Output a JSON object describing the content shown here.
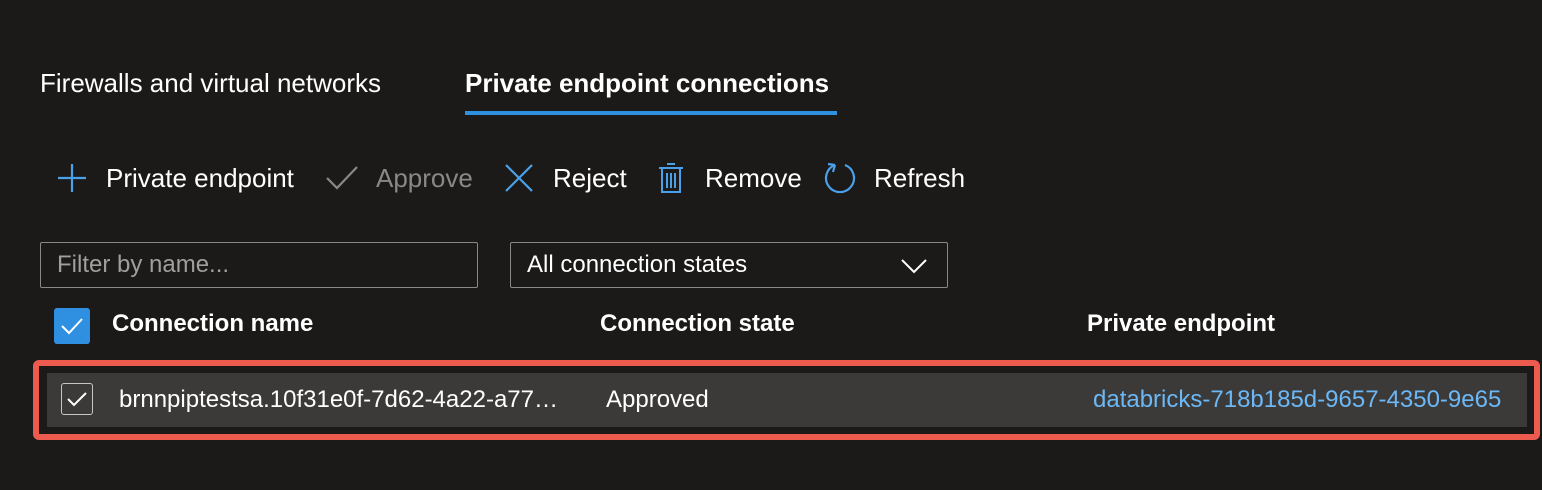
{
  "tabs": [
    {
      "label": "Firewalls and virtual networks",
      "active": false
    },
    {
      "label": "Private endpoint connections",
      "active": true
    }
  ],
  "toolbar": {
    "add_label": "Private endpoint",
    "approve_label": "Approve",
    "reject_label": "Reject",
    "remove_label": "Remove",
    "refresh_label": "Refresh"
  },
  "filters": {
    "name_placeholder": "Filter by name...",
    "state_selected": "All connection states"
  },
  "table": {
    "columns": [
      "Connection name",
      "Connection state",
      "Private endpoint"
    ],
    "rows": [
      {
        "connection_name": "brnnpiptestsa.10f31e0f-7d62-4a22-a77…",
        "connection_state": "Approved",
        "private_endpoint": "databricks-718b185d-9657-4350-9e65",
        "selected": true
      }
    ]
  },
  "colors": {
    "accent": "#2f8fe0",
    "highlight_border": "#ec5b4d",
    "link": "#6cb8f6",
    "background": "#1b1a19"
  },
  "icons": [
    "add-icon",
    "checkmark-icon",
    "close-icon",
    "trash-icon",
    "refresh-icon",
    "chevron-down-icon"
  ]
}
